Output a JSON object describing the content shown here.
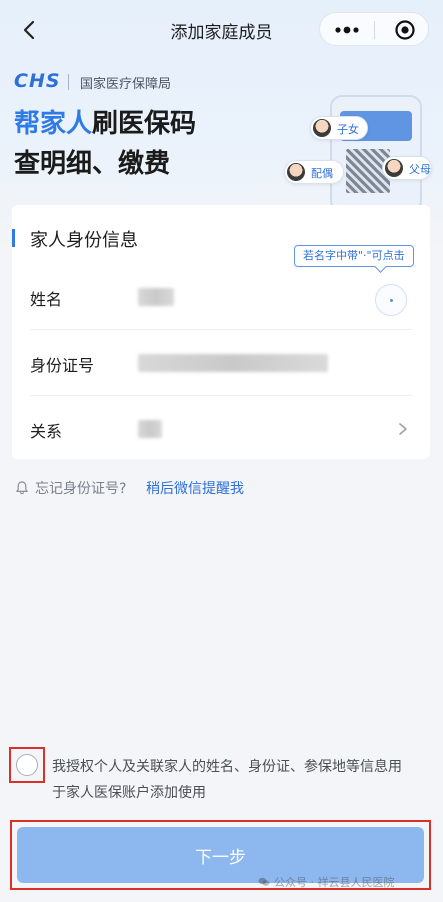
{
  "nav": {
    "title": "添加家庭成员"
  },
  "brand": {
    "logo_text": "CHS",
    "org_name": "国家医疗保障局"
  },
  "headline": {
    "highlight": "帮家人",
    "line1_rest": "刷医保码",
    "line2": "查明细、缴费"
  },
  "illustration": {
    "tags": [
      "子女",
      "配偶",
      "父母"
    ]
  },
  "form": {
    "section_title": "家人身份信息",
    "name_tip": "若名字中带\"·\"可点击",
    "fields": [
      {
        "label": "姓名"
      },
      {
        "label": "身份证号"
      },
      {
        "label": "关系"
      }
    ]
  },
  "forgot": {
    "question": "忘记身份证号?",
    "link": "稍后微信提醒我"
  },
  "consent": {
    "text": "我授权个人及关联家人的姓名、身份证、参保地等信息用于家人医保账户添加使用"
  },
  "next_button": {
    "label": "下一步"
  },
  "watermark": {
    "text": "公众号 · 祥云县人民医院"
  },
  "colors": {
    "primary": "#2f7ae5",
    "button_disabled": "#8db8ef",
    "highlight_frame": "#d9302a"
  }
}
